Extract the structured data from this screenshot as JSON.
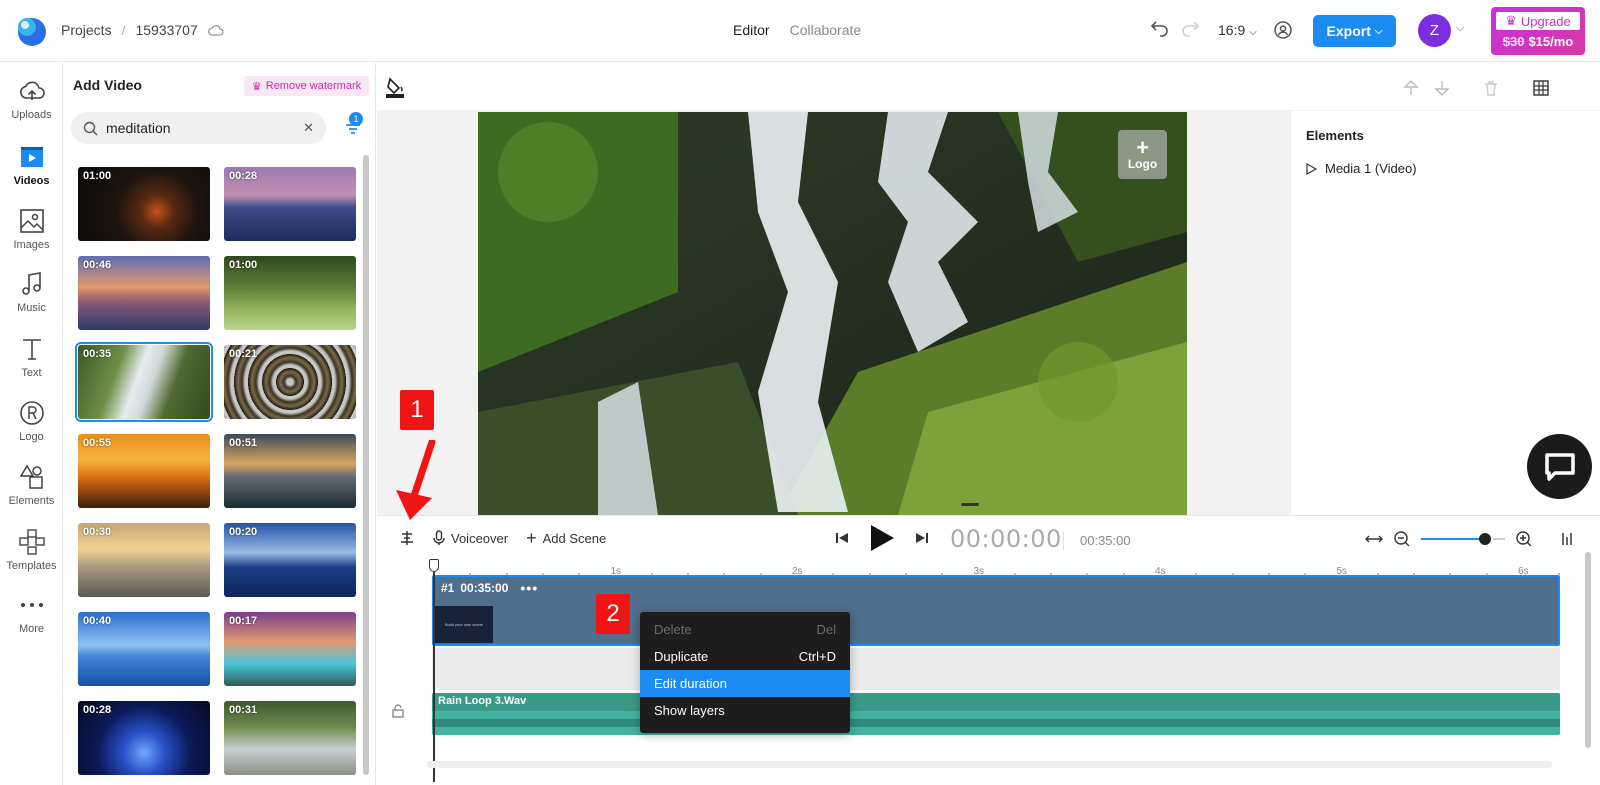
{
  "header": {
    "breadcrumb": [
      "Projects",
      "15933707"
    ],
    "tabs": [
      {
        "label": "Editor",
        "active": true
      },
      {
        "label": "Collaborate",
        "active": false
      }
    ],
    "aspect_ratio": "16:9",
    "export_label": "Export",
    "avatar_initial": "Z",
    "upgrade": {
      "label": "Upgrade",
      "old_price": "$30",
      "new_price": "$15/mo"
    }
  },
  "rail": {
    "items": [
      {
        "label": "Uploads",
        "icon": "cloud-upload-icon",
        "active": false
      },
      {
        "label": "Videos",
        "icon": "video-icon",
        "active": true
      },
      {
        "label": "Images",
        "icon": "image-icon",
        "active": false
      },
      {
        "label": "Music",
        "icon": "music-note-icon",
        "active": false
      },
      {
        "label": "Text",
        "icon": "text-icon",
        "active": false
      },
      {
        "label": "Logo",
        "icon": "registered-logo-icon",
        "active": false
      },
      {
        "label": "Elements",
        "icon": "shapes-icon",
        "active": false
      },
      {
        "label": "Templates",
        "icon": "templates-icon",
        "active": false
      },
      {
        "label": "More",
        "icon": "more-dots-icon",
        "active": false
      }
    ]
  },
  "panel": {
    "title": "Add Video",
    "watermark_label": "Remove watermark",
    "search_value": "meditation",
    "filter_count": "1",
    "thumbnails": [
      {
        "duration": "01:00",
        "theme": "fireplace",
        "selected": false
      },
      {
        "duration": "00:28",
        "theme": "ocean-sunset-purple",
        "selected": false
      },
      {
        "duration": "00:46",
        "theme": "sunset-sky",
        "selected": false
      },
      {
        "duration": "01:00",
        "theme": "grass-forest",
        "selected": false
      },
      {
        "duration": "00:35",
        "theme": "waterfall",
        "selected": true
      },
      {
        "duration": "00:21",
        "theme": "spiral-tunnel",
        "selected": false
      },
      {
        "duration": "00:55",
        "theme": "orange-sunset",
        "selected": false
      },
      {
        "duration": "00:51",
        "theme": "dusk-sea",
        "selected": false
      },
      {
        "duration": "00:30",
        "theme": "golden-beach",
        "selected": false
      },
      {
        "duration": "00:20",
        "theme": "stones-reflection",
        "selected": false
      },
      {
        "duration": "00:40",
        "theme": "cloud-reflection",
        "selected": false
      },
      {
        "duration": "00:17",
        "theme": "waterfall-sunset",
        "selected": false
      },
      {
        "duration": "00:28",
        "theme": "blue-portal",
        "selected": false
      },
      {
        "duration": "00:31",
        "theme": "forest-river",
        "selected": false
      }
    ]
  },
  "stage": {
    "logo_slot_label": "Logo",
    "elements_title": "Elements",
    "elements_items": [
      "Media 1 (Video)"
    ]
  },
  "timeline": {
    "voiceover_label": "Voiceover",
    "add_scene_label": "Add Scene",
    "time_current": "00:00:00",
    "time_total": "00:35:00",
    "ruler_labels": [
      "1s",
      "2s",
      "3s",
      "4s",
      "5s",
      "6s"
    ],
    "scene": {
      "index": "#1",
      "duration": "00:35:00",
      "thumb_text": "Build your own scene"
    },
    "audio_label": "Rain Loop 3.Wav"
  },
  "context_menu": {
    "items": [
      {
        "label": "Delete",
        "shortcut": "Del",
        "disabled": true,
        "highlighted": false
      },
      {
        "label": "Duplicate",
        "shortcut": "Ctrl+D",
        "disabled": false,
        "highlighted": false
      },
      {
        "label": "Edit duration",
        "shortcut": "",
        "disabled": false,
        "highlighted": true
      },
      {
        "label": "Show layers",
        "shortcut": "",
        "disabled": false,
        "highlighted": false
      }
    ]
  },
  "annotations": {
    "marker_1": "1",
    "marker_2": "2"
  },
  "colors": {
    "accent": "#1c8cf2",
    "upgrade": "#d034bd",
    "avatar": "#7b2de0",
    "scene_track": "#4f6f8c",
    "audio_track": "#42b3a0",
    "annotation": "#f01414"
  }
}
